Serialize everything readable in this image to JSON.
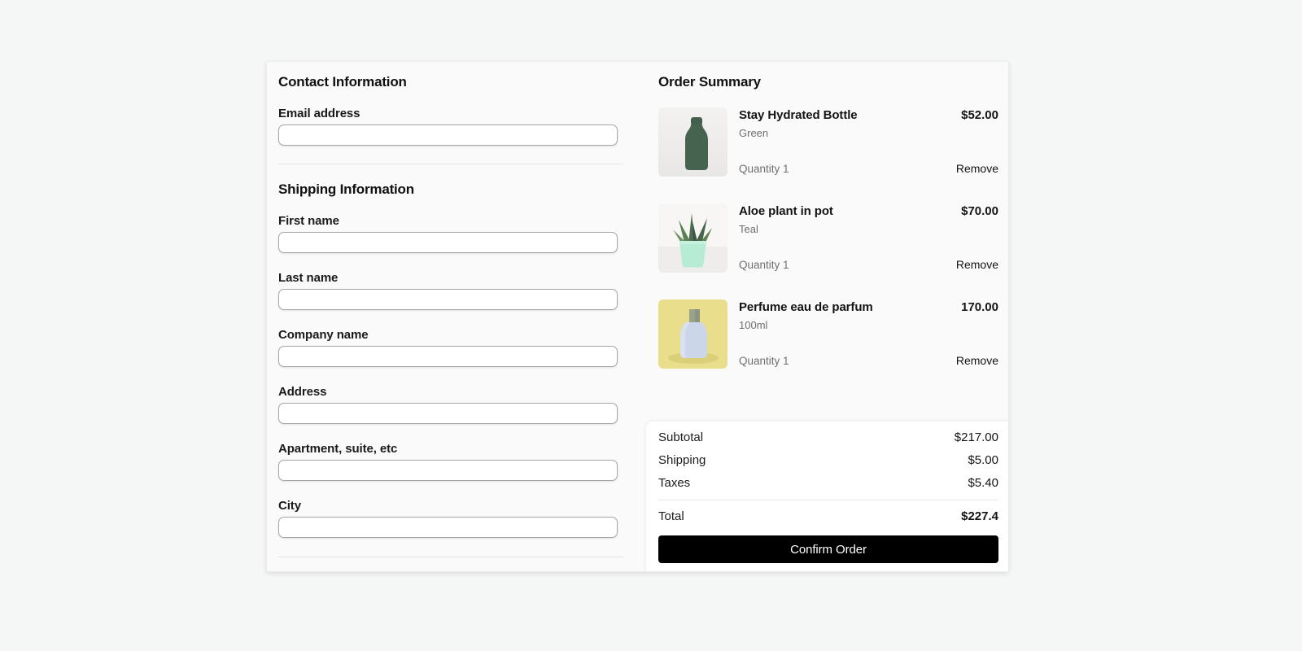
{
  "theme": {
    "page_background": "#f5f6f6",
    "card_background": "#fafafa",
    "accent_button_color": "#000000",
    "accent_button_text_color": "#ffffff"
  },
  "contact": {
    "title": "Contact Information",
    "fields": [
      {
        "label": "Email address",
        "value": "",
        "placeholder": ""
      }
    ]
  },
  "shipping": {
    "title": "Shipping Information",
    "fields": [
      {
        "label": "First name",
        "value": "",
        "placeholder": ""
      },
      {
        "label": "Last name",
        "value": "",
        "placeholder": ""
      },
      {
        "label": "Company name",
        "value": "",
        "placeholder": ""
      },
      {
        "label": "Address",
        "value": "",
        "placeholder": ""
      },
      {
        "label": "Apartment, suite, etc",
        "value": "",
        "placeholder": ""
      },
      {
        "label": "City",
        "value": "",
        "placeholder": ""
      }
    ]
  },
  "order_summary": {
    "title": "Order Summary",
    "items": [
      {
        "name": "Stay Hydrated Bottle",
        "variant": "Green",
        "price": "$52.00",
        "quantity_label": "Quantity 1",
        "remove_label": "Remove",
        "image": "green-bottle-photo"
      },
      {
        "name": "Aloe plant in pot",
        "variant": "Teal",
        "price": "$70.00",
        "quantity_label": "Quantity 1",
        "remove_label": "Remove",
        "image": "aloe-plant-photo"
      },
      {
        "name": "Perfume eau de parfum",
        "variant": "100ml",
        "price": "170.00",
        "quantity_label": "Quantity 1",
        "remove_label": "Remove",
        "image": "perfume-bottle-photo"
      }
    ],
    "totals": {
      "subtotal_label": "Subtotal",
      "subtotal_value": "$217.00",
      "shipping_label": "Shipping",
      "shipping_value": "$5.00",
      "taxes_label": "Taxes",
      "taxes_value": "$5.40",
      "total_label": "Total",
      "total_value": "$227.4"
    },
    "confirm_button_label": "Confirm Order"
  }
}
